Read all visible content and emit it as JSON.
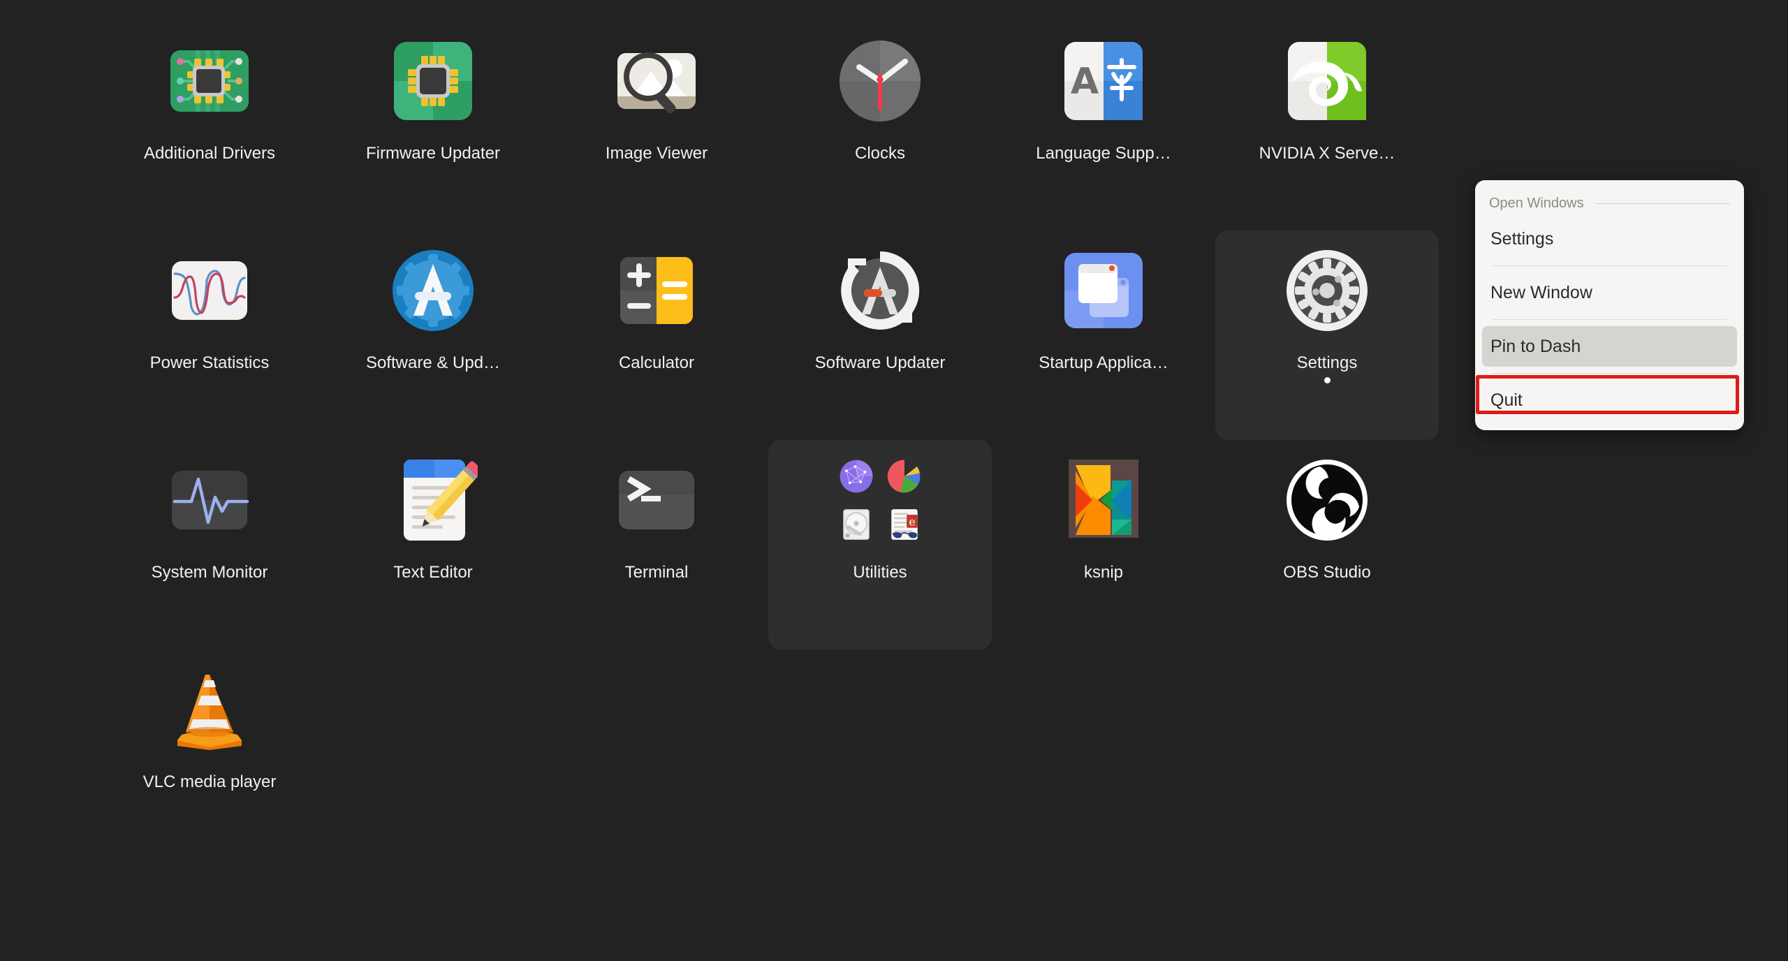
{
  "desktop": {
    "background_color": "#222222",
    "view": "Applications grid"
  },
  "app_grid": {
    "rows": [
      [
        {
          "label": "Additional Drivers",
          "icon": "chip-circuit-board-icon",
          "running": false,
          "highlight": false
        },
        {
          "label": "Firmware Updater",
          "icon": "chip-firmware-icon",
          "running": false,
          "highlight": false
        },
        {
          "label": "Image Viewer",
          "icon": "magnifier-photo-icon",
          "running": false,
          "highlight": false
        },
        {
          "label": "Clocks",
          "icon": "analog-clock-icon",
          "running": false,
          "highlight": false
        },
        {
          "label": "Language Supp…",
          "icon": "language-translate-icon",
          "running": false,
          "highlight": false
        },
        {
          "label": "NVIDIA X Serve…",
          "icon": "nvidia-eye-icon",
          "running": false,
          "highlight": false
        }
      ],
      [
        {
          "label": "Power Statistics",
          "icon": "power-graph-icon",
          "running": false,
          "highlight": false
        },
        {
          "label": "Software & Upd…",
          "icon": "software-gear-a-icon",
          "running": false,
          "highlight": false
        },
        {
          "label": "Calculator",
          "icon": "calculator-icon",
          "running": false,
          "highlight": false
        },
        {
          "label": "Software Updater",
          "icon": "software-updater-icon",
          "running": false,
          "highlight": false
        },
        {
          "label": "Startup Applica…",
          "icon": "startup-windows-icon",
          "running": false,
          "highlight": false
        },
        {
          "label": "Settings",
          "icon": "settings-gear-icon",
          "running": true,
          "highlight": true
        }
      ],
      [
        {
          "label": "System Monitor",
          "icon": "system-monitor-pulse-icon",
          "running": false,
          "highlight": false
        },
        {
          "label": "Text Editor",
          "icon": "text-editor-pencil-icon",
          "running": false,
          "highlight": false
        },
        {
          "label": "Terminal",
          "icon": "terminal-prompt-icon",
          "running": false,
          "highlight": false
        },
        {
          "label": "Utilities",
          "icon": "utilities-folder-icon",
          "running": false,
          "highlight": false,
          "folder": true,
          "folder_items": [
            "network-sphere-icon",
            "disk-usage-pie-icon",
            "hard-disk-icon",
            "ebook-reader-icon"
          ]
        },
        {
          "label": "ksnip",
          "icon": "ksnip-k-icon",
          "running": false,
          "highlight": false
        },
        {
          "label": "OBS Studio",
          "icon": "obs-studio-icon",
          "running": false,
          "highlight": false
        }
      ],
      [
        {
          "label": "VLC media player",
          "icon": "vlc-cone-icon",
          "running": false,
          "highlight": false
        }
      ]
    ]
  },
  "context_menu": {
    "header_label": "Open Windows",
    "items": [
      {
        "label": "Settings",
        "active": false
      },
      {
        "label": "New Window",
        "active": false
      },
      {
        "label": "Pin to Dash",
        "active": true
      },
      {
        "label": "Quit",
        "active": false
      }
    ]
  },
  "annotation": {
    "highlight_color": "#e01b1b",
    "target_label": "Pin to Dash"
  }
}
